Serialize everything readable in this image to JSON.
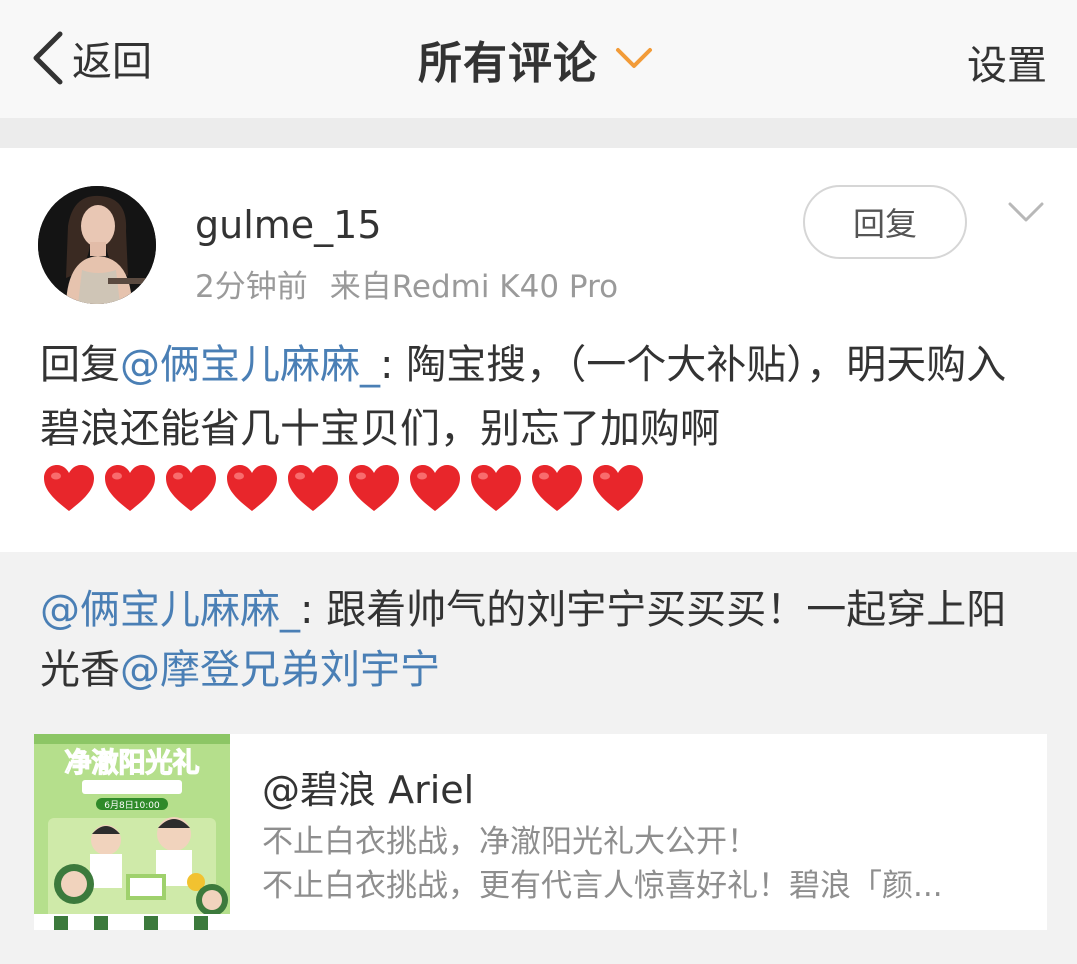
{
  "nav": {
    "back_label": "返回",
    "title": "所有评论",
    "settings_label": "设置"
  },
  "comment": {
    "username": "gulme_15",
    "time": "2分钟前",
    "source": "来自Redmi K40 Pro",
    "reply_button": "回复",
    "text_prefix": "回复",
    "mention": "@俩宝儿麻麻_",
    "text_body": ": 陶宝搜，（一个大补贴），明天购入碧浪还能省几十宝贝们，别忘了加购啊",
    "heart_count": 10,
    "heart_color": "#e8262b"
  },
  "quote": {
    "mention_1": "@俩宝儿麻麻_",
    "text": ": 跟着帅气的刘宇宁买买买！一起穿上阳光香",
    "mention_2": "@摩登兄弟刘宇宁"
  },
  "card": {
    "image_title": "净澈阳光礼",
    "image_date": "6月8日10:00",
    "title": "@碧浪 Ariel",
    "desc_line1": "不止白衣挑战，净澈阳光礼大公开！",
    "desc_line2": "不止白衣挑战，更有代言人惊喜好礼！碧浪「颜..."
  },
  "colors": {
    "mention": "#4a7fb5",
    "accent": "#f29b38"
  }
}
